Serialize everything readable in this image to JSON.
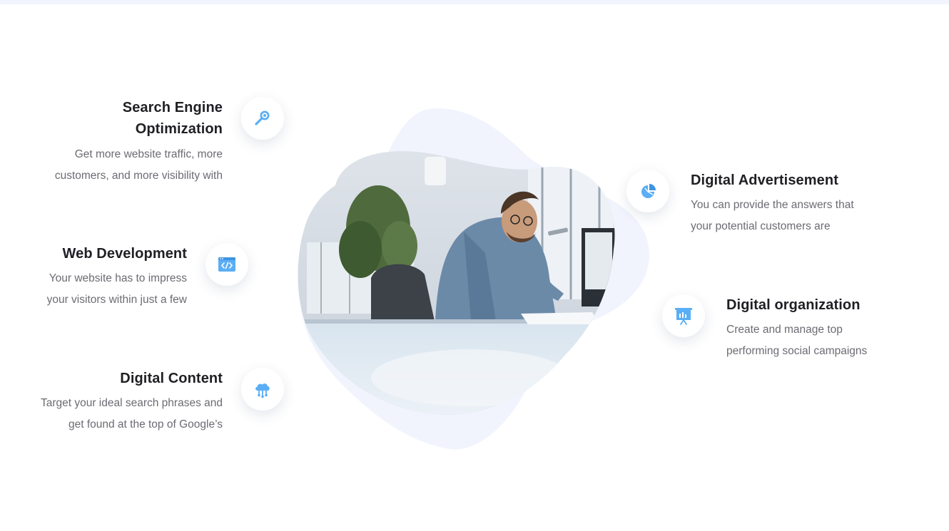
{
  "features": {
    "seo": {
      "title_line1": "Search Engine",
      "title_line2": "Optimization",
      "desc_line1": "Get more website traffic, more",
      "desc_line2": "customers, and more visibility with",
      "icon": "magnifier-icon"
    },
    "web": {
      "title": "Web Development",
      "desc_line1": "Your website has to impress",
      "desc_line2": "your visitors within just a few",
      "icon": "code-window-icon"
    },
    "content": {
      "title": "Digital Content",
      "desc_line1": "Target your ideal search phrases and",
      "desc_line2": "get found at the top of Google’s",
      "icon": "cloud-network-icon"
    },
    "ads": {
      "title": "Digital Advertisement",
      "desc_line1": "You can provide the answers that",
      "desc_line2": "your potential customers are",
      "icon": "pie-chart-icon"
    },
    "org": {
      "title": "Digital organization",
      "desc_line1": "Create and manage top",
      "desc_line2": "performing social campaigns",
      "icon": "presentation-board-icon"
    }
  },
  "colors": {
    "icon_blue": "#5aaef5",
    "blob": "#f1f4fd",
    "heading": "#1f1f24",
    "body_text": "#6b6b73"
  },
  "hero_image": {
    "icon": "man-at-desk-photo"
  }
}
